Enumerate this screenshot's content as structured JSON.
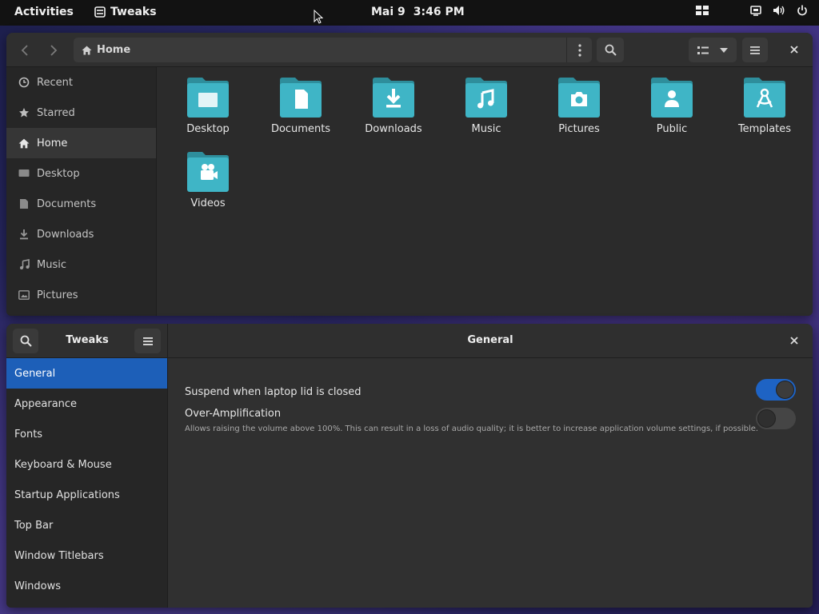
{
  "topbar": {
    "activities": "Activities",
    "app_name": "Tweaks",
    "date": "Mai 9",
    "time": "3:46 PM"
  },
  "files": {
    "path_home": "Home",
    "sidebar": [
      {
        "label": "Recent",
        "icon": "clock-icon"
      },
      {
        "label": "Starred",
        "icon": "star-icon"
      },
      {
        "label": "Home",
        "icon": "home-icon",
        "active": true
      },
      {
        "label": "Desktop",
        "icon": "desktop-icon"
      },
      {
        "label": "Documents",
        "icon": "document-icon"
      },
      {
        "label": "Downloads",
        "icon": "download-icon"
      },
      {
        "label": "Music",
        "icon": "music-icon"
      },
      {
        "label": "Pictures",
        "icon": "picture-icon"
      }
    ],
    "folders": [
      {
        "label": "Desktop",
        "icon": "desktop"
      },
      {
        "label": "Documents",
        "icon": "documents"
      },
      {
        "label": "Downloads",
        "icon": "downloads"
      },
      {
        "label": "Music",
        "icon": "music"
      },
      {
        "label": "Pictures",
        "icon": "pictures"
      },
      {
        "label": "Public",
        "icon": "public"
      },
      {
        "label": "Templates",
        "icon": "templates"
      },
      {
        "label": "Videos",
        "icon": "videos"
      }
    ],
    "folder_color": "#3fb5c6"
  },
  "tweaks": {
    "title": "Tweaks",
    "section_title": "General",
    "sidebar": [
      {
        "label": "General",
        "active": true
      },
      {
        "label": "Appearance"
      },
      {
        "label": "Fonts"
      },
      {
        "label": "Keyboard & Mouse"
      },
      {
        "label": "Startup Applications"
      },
      {
        "label": "Top Bar"
      },
      {
        "label": "Window Titlebars"
      },
      {
        "label": "Windows"
      }
    ],
    "settings": {
      "suspend_label": "Suspend when laptop lid is closed",
      "suspend_on": true,
      "overamp_label": "Over-Amplification",
      "overamp_desc": "Allows raising the volume above 100%. This can result in a loss of audio quality; it is better to increase application volume settings, if possible.",
      "overamp_on": false
    },
    "accent": "#1d5fb8"
  }
}
